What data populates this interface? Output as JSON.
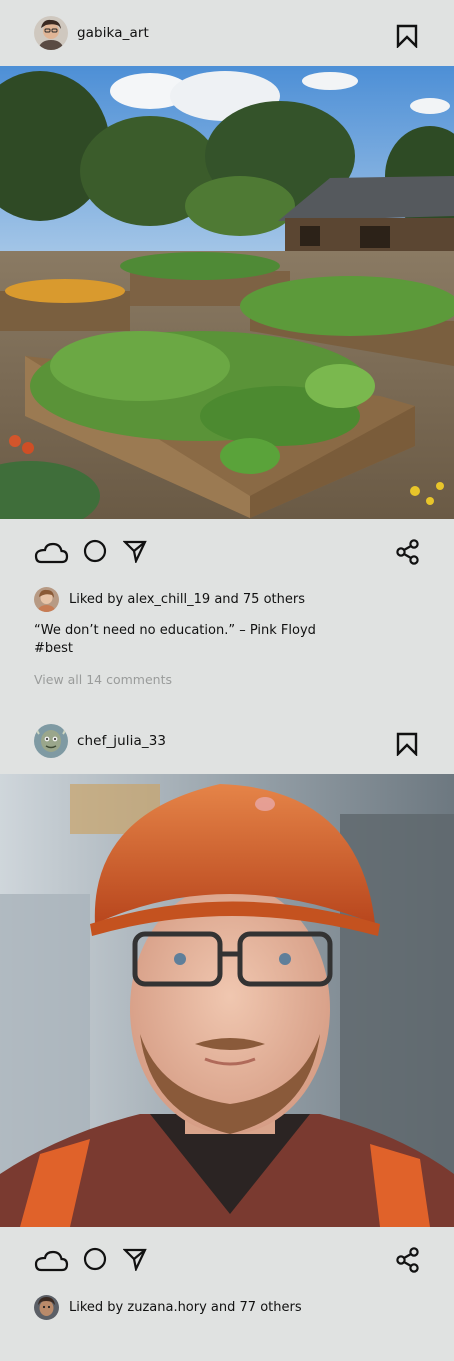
{
  "posts": [
    {
      "username": "gabika_art",
      "photo_subject": "raised-bed vegetable garden",
      "likes_text": "Liked by alex_chill_19 and 75 others",
      "caption_line1": "“We don’t need no education.” – Pink Floyd",
      "caption_line2": "#best",
      "comments_link": "View all 14 comments"
    },
    {
      "username": "chef_julia_33",
      "photo_subject": "construction worker in orange hard hat",
      "likes_text": "Liked by zuzana.hory and 77 others"
    }
  ],
  "icons": {
    "like": "cloud-icon",
    "comment": "circle-icon",
    "share_direct": "send-icon",
    "share": "share-icon",
    "save": "bookmark-icon"
  },
  "colors": {
    "background": "#e0e2e1",
    "text": "#111111",
    "muted": "#9a9c9b"
  }
}
